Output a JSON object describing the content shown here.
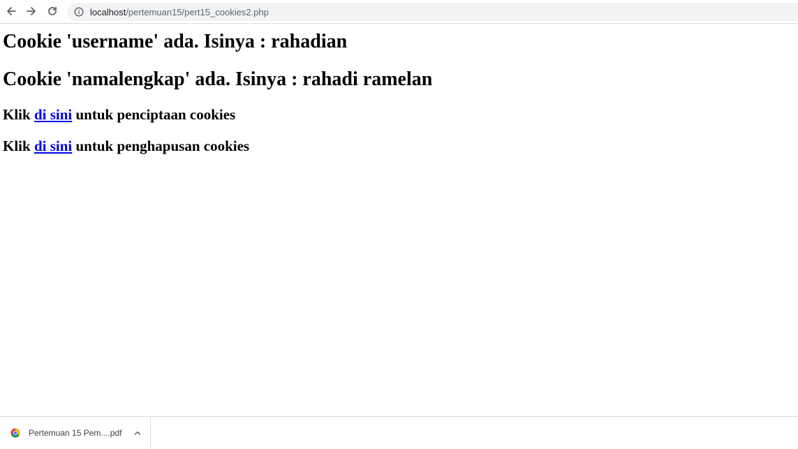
{
  "browser": {
    "url_host": "localhost",
    "url_path": "/pertemuan15/pert15_cookies2.php",
    "icons": {
      "back": "arrow-left-icon",
      "forward": "arrow-right-icon",
      "reload": "reload-icon",
      "site_info": "info-icon"
    }
  },
  "page": {
    "heading_username": "Cookie 'username' ada. Isinya : rahadian",
    "heading_namalengkap": "Cookie 'namalengkap' ada. Isinya : rahadi ramelan",
    "create_line": {
      "prefix": "Klik ",
      "link": "di sini",
      "suffix": " untuk penciptaan cookies"
    },
    "delete_line": {
      "prefix": "Klik ",
      "link": "di sini",
      "suffix": " untuk penghapusan cookies"
    },
    "link_color": "#0000ee"
  },
  "downloads": {
    "items": [
      {
        "name": "Pertemuan 15 Pem....pdf",
        "icon": "chrome-icon"
      }
    ]
  }
}
